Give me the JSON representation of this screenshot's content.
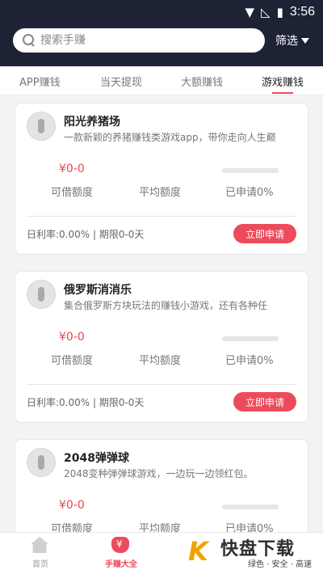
{
  "status_bar": {
    "time": "3:56",
    "icons": [
      "wifi-icon",
      "no-signal-icon",
      "battery-charging-icon"
    ]
  },
  "header": {
    "search_placeholder": "搜索手赚",
    "filter_label": "筛选",
    "colors": {
      "background": "#1d2334"
    }
  },
  "tabs": [
    {
      "label": "APP赚钱",
      "active": false
    },
    {
      "label": "当天提现",
      "active": false
    },
    {
      "label": "大额赚钱",
      "active": false
    },
    {
      "label": "游戏赚钱",
      "active": true
    }
  ],
  "cards": [
    {
      "name": "阳光养猪场",
      "desc": "一款新颖的养猪赚钱类游戏app，带你走向人生巅",
      "amount": "¥0-0",
      "progress": 0,
      "stats": [
        "可借额度",
        "平均额度",
        "已申请0%"
      ],
      "footer": "日利率:0.00% | 期限0-0天",
      "button": "立即申请"
    },
    {
      "name": "俄罗斯消消乐",
      "desc": "集合俄罗斯方块玩法的赚钱小游戏，还有各种任",
      "amount": "¥0-0",
      "progress": 0,
      "stats": [
        "可借额度",
        "平均额度",
        "已申请0%"
      ],
      "footer": "日利率:0.00% | 期限0-0天",
      "button": "立即申请"
    },
    {
      "name": "2048弹弹球",
      "desc": "2048变种弹弹球游戏，一边玩一边领红包。",
      "amount": "¥0-0",
      "progress": 0,
      "stats": [
        "可借额度",
        "平均额度",
        "已申请0%"
      ],
      "footer": "",
      "button": ""
    }
  ],
  "nav": [
    {
      "label": "首页",
      "active": false,
      "icon": "home-icon"
    },
    {
      "label": "手赚大全",
      "active": true,
      "icon": "money-bag-icon"
    },
    {
      "label": "",
      "active": false,
      "icon": "nav-icon"
    },
    {
      "label": "",
      "active": false,
      "icon": "nav-icon"
    }
  ],
  "watermark": {
    "glyph": "K",
    "title": "快盘下载",
    "subtitle": "绿色 · 安全 · 高速"
  },
  "colors": {
    "accent": "#ec4b5b",
    "amount": "#e8474f",
    "tab_underline": "#f04a5b"
  }
}
